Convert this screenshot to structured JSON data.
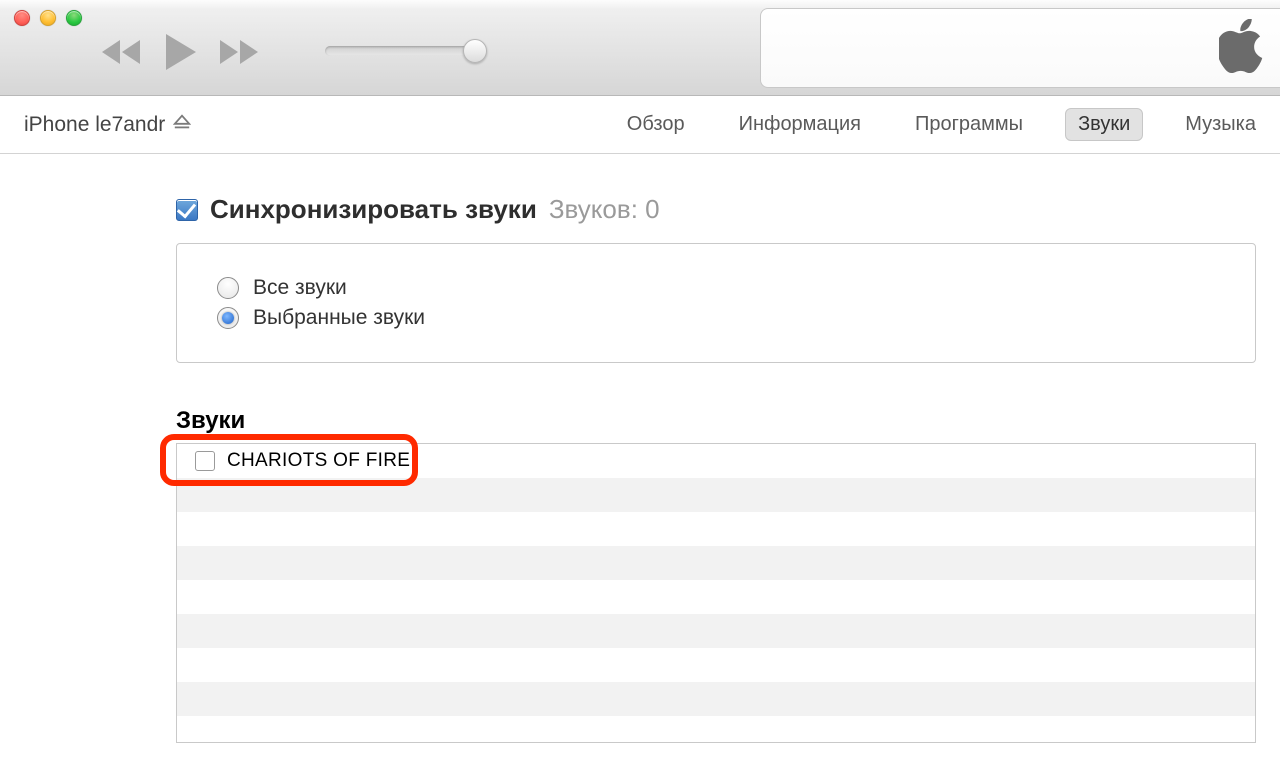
{
  "device": {
    "name": "iPhone le7andr"
  },
  "tabs": {
    "overview": "Обзор",
    "info": "Информация",
    "apps": "Программы",
    "sounds": "Звуки",
    "music": "Музыка"
  },
  "sync": {
    "checkbox_checked": true,
    "label": "Синхронизировать звуки",
    "count_label": "Звуков: 0",
    "radio_all": "Все звуки",
    "radio_selected": "Выбранные звуки",
    "radio_choice": "selected"
  },
  "sounds": {
    "heading": "Звуки",
    "items": [
      {
        "label": "CHARIOTS OF FIRE",
        "checked": false
      }
    ]
  }
}
